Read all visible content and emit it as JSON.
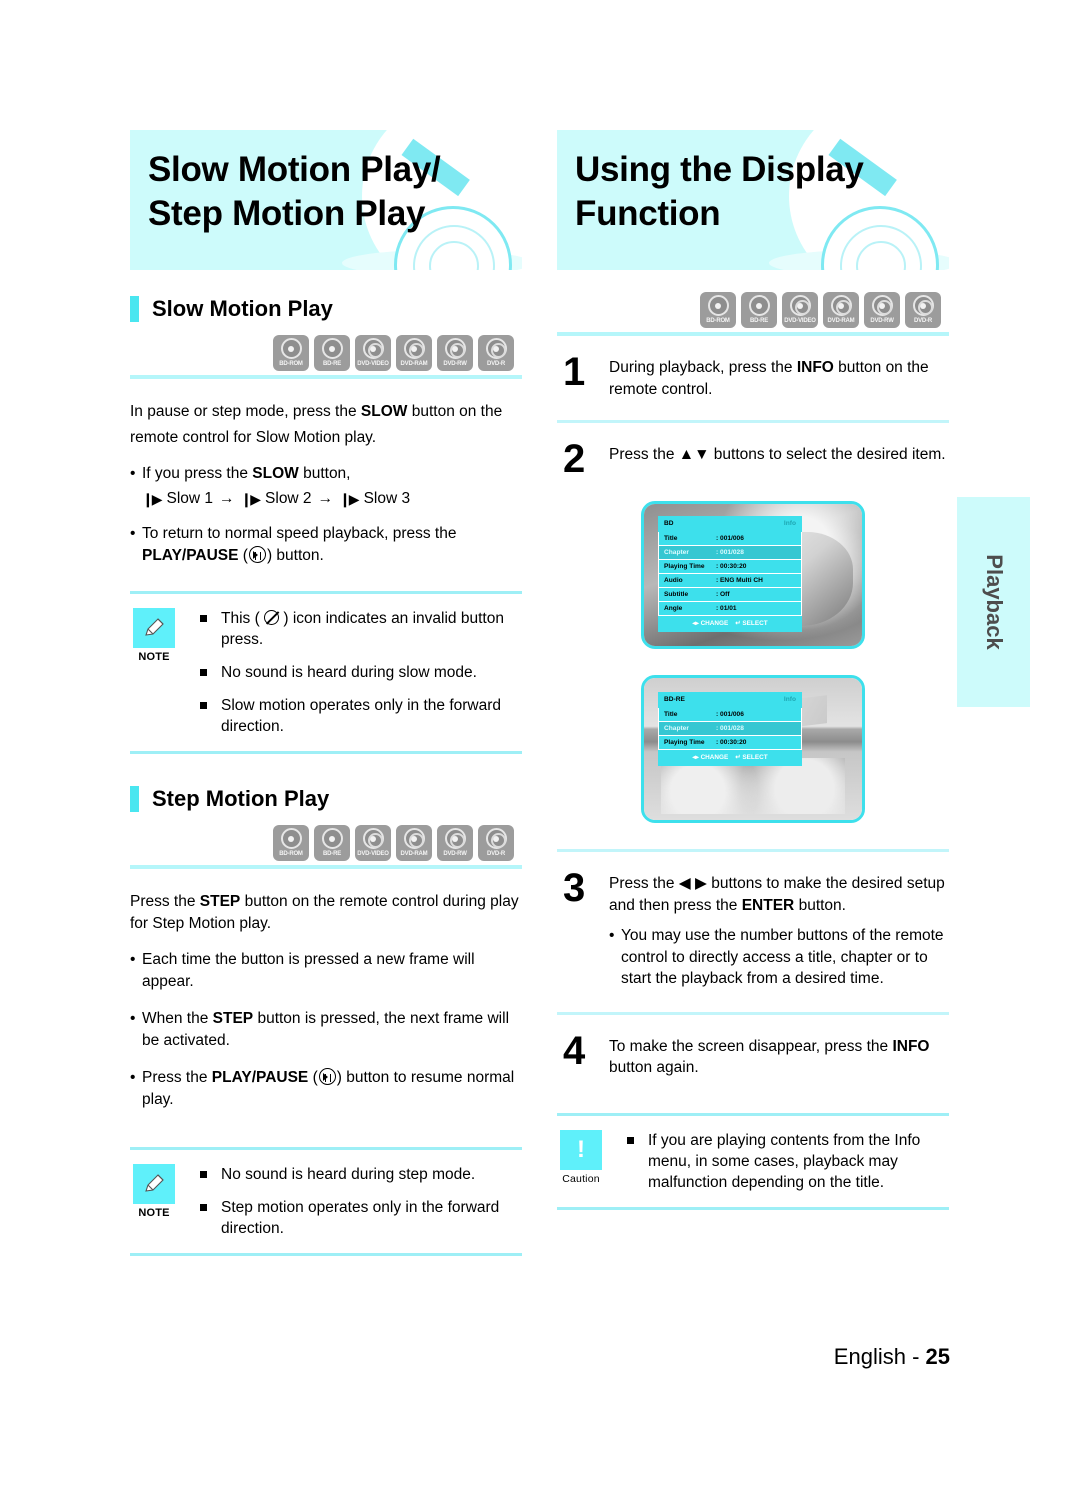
{
  "page": {
    "footer_label": "English - ",
    "footer_number": "25",
    "side_tab": "Playback"
  },
  "disc_badges": [
    {
      "label": "BD-ROM",
      "kind": "bd"
    },
    {
      "label": "BD-RE",
      "kind": "bd"
    },
    {
      "label": "DVD-VIDEO",
      "kind": "dvd"
    },
    {
      "label": "DVD-RAM",
      "kind": "dvd"
    },
    {
      "label": "DVD-RW",
      "kind": "dvd"
    },
    {
      "label": "DVD-R",
      "kind": "dvd"
    }
  ],
  "left": {
    "banner_title": "Slow Motion Play/\nStep Motion Play",
    "slow": {
      "heading": "Slow Motion Play",
      "intro_line1": "In pause or step mode, press the ",
      "intro_bold": "SLOW",
      "intro_line2": " button on the",
      "intro_line3": "remote control for Slow Motion play.",
      "bullet1_pre": "If you press the ",
      "bullet1_bold": "SLOW",
      "bullet1_post": " button,",
      "seq1": "Slow 1",
      "seq_arrow": "→",
      "seq2": "Slow 2",
      "seq3": "Slow 3",
      "bullet2_line1": "To return to normal speed playback, press the",
      "bullet2_bold": "PLAY/PAUSE",
      "bullet2_open": " (",
      "bullet2_close": ") button."
    },
    "note1": {
      "badge_label": "NOTE",
      "item1_pre": "This (",
      "item1_post": ") icon indicates an invalid button press.",
      "item2": "No sound is heard during slow mode.",
      "item3": "Slow motion operates only in the forward direction."
    },
    "step": {
      "heading": "Step Motion Play",
      "intro_pre": "Press the ",
      "intro_bold": "STEP",
      "intro_post": " button on the remote control during play for Step Motion play.",
      "bullet1": "Each time the button is pressed a new frame will appear.",
      "bullet2_pre": "When the ",
      "bullet2_bold": "STEP",
      "bullet2_post": " button is pressed, the next frame will be activated.",
      "bullet3_pre": "Press the ",
      "bullet3_bold": "PLAY/PAUSE",
      "bullet3_open": " (",
      "bullet3_close": ") button to resume normal play."
    },
    "note2": {
      "badge_label": "NOTE",
      "item1": "No sound is heard during step mode.",
      "item2": "Step motion operates only in the forward direction."
    }
  },
  "right": {
    "banner_title": "Using the Display\nFunction",
    "steps": [
      {
        "num": "1",
        "pre": "During playback, press the ",
        "bold": "INFO",
        "post": " button on the remote control."
      },
      {
        "num": "2",
        "pre": "Press the ",
        "bold": "▲▼",
        "post": " buttons to select the desired item."
      },
      {
        "num": "3",
        "pre": "Press the ◀ ▶ buttons to make the desired setup and then press the ",
        "bold": "ENTER",
        "post": " button."
      },
      {
        "num": "4",
        "pre": "To make the screen disappear, press the ",
        "bold": "INFO",
        "post": " button again."
      }
    ],
    "step3_sub": "You may use the number buttons of the remote control to directly access a title, chapter or to start the playback from a desired time.",
    "caution": {
      "badge_label": "Caution",
      "badge_glyph": "!",
      "item1": "If you are playing contents from the Info menu, in some cases, playback may malfunction depending on the title."
    }
  },
  "osd_screens": [
    {
      "name": "bd-info-osd",
      "title": "BD",
      "header_right": "Info",
      "rows": [
        {
          "key": "Title",
          "value": ": 001/006",
          "selected": false
        },
        {
          "key": "Chapter",
          "value": ": 001/028",
          "selected": true
        },
        {
          "key": "Playing Time",
          "value": ": 00:30:20",
          "selected": false
        },
        {
          "key": "Audio",
          "value": ": ENG Multi CH",
          "selected": false
        },
        {
          "key": "Subtitle",
          "value": ": Off",
          "selected": false
        },
        {
          "key": "Angle",
          "value": ": 01/01",
          "selected": false
        }
      ],
      "foot_change": "◂▸ CHANGE",
      "foot_select": "↵ SELECT"
    },
    {
      "name": "bdre-info-osd",
      "title": "BD-RE",
      "header_right": "Info",
      "rows": [
        {
          "key": "Title",
          "value": ": 001/006",
          "selected": false
        },
        {
          "key": "Chapter",
          "value": ": 001/028",
          "selected": true
        },
        {
          "key": "Playing Time",
          "value": ": 00:30:20",
          "selected": false
        }
      ],
      "foot_change": "◂▸ CHANGE",
      "foot_select": "↵ SELECT"
    }
  ],
  "colors": {
    "banner_bg": "#cdfbfb",
    "accent_cyan": "#4ae6f0",
    "rule_cyan": "#9eeff6",
    "badge_gray": "#9c9c9c"
  }
}
